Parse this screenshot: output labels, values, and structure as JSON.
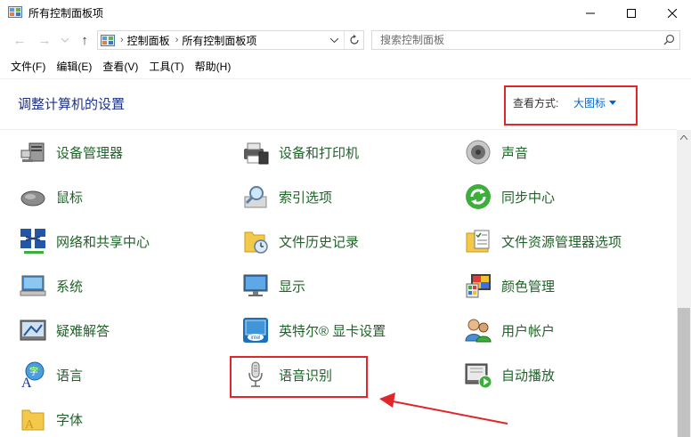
{
  "window": {
    "title": "所有控制面板项"
  },
  "address": {
    "crumbs": [
      "控制面板",
      "所有控制面板项"
    ]
  },
  "search": {
    "placeholder": "搜索控制面板"
  },
  "menu": [
    {
      "label": "文件(F)"
    },
    {
      "label": "编辑(E)"
    },
    {
      "label": "查看(V)"
    },
    {
      "label": "工具(T)"
    },
    {
      "label": "帮助(H)"
    }
  ],
  "header": {
    "title": "调整计算机的设置",
    "view_label": "查看方式:",
    "view_value": "大图标"
  },
  "items": [
    {
      "label": "设备管理器",
      "icon": "device-manager-icon"
    },
    {
      "label": "设备和打印机",
      "icon": "devices-printers-icon"
    },
    {
      "label": "声音",
      "icon": "sound-icon"
    },
    {
      "label": "鼠标",
      "icon": "mouse-icon"
    },
    {
      "label": "索引选项",
      "icon": "indexing-options-icon"
    },
    {
      "label": "同步中心",
      "icon": "sync-center-icon"
    },
    {
      "label": "网络和共享中心",
      "icon": "network-sharing-icon"
    },
    {
      "label": "文件历史记录",
      "icon": "file-history-icon"
    },
    {
      "label": "文件资源管理器选项",
      "icon": "explorer-options-icon"
    },
    {
      "label": "系统",
      "icon": "system-icon"
    },
    {
      "label": "显示",
      "icon": "display-icon"
    },
    {
      "label": "颜色管理",
      "icon": "color-management-icon"
    },
    {
      "label": "疑难解答",
      "icon": "troubleshooting-icon"
    },
    {
      "label": "英特尔® 显卡设置",
      "icon": "intel-graphics-icon"
    },
    {
      "label": "用户帐户",
      "icon": "user-accounts-icon"
    },
    {
      "label": "语言",
      "icon": "language-icon"
    },
    {
      "label": "语音识别",
      "icon": "microphone-icon"
    },
    {
      "label": "自动播放",
      "icon": "autoplay-icon"
    },
    {
      "label": "字体",
      "icon": "fonts-icon"
    }
  ],
  "colors": {
    "item_text": "#1f6428",
    "heading": "#1e3287",
    "link": "#0066cc",
    "annotation": "#e0262b"
  }
}
